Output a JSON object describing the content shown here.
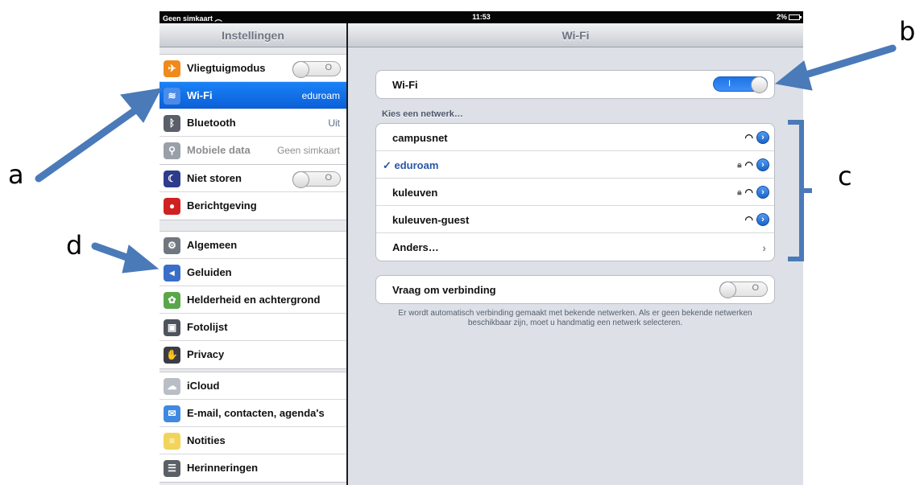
{
  "status_bar": {
    "carrier": "Geen simkaart",
    "time": "11:53",
    "battery": "2%"
  },
  "sidebar": {
    "title": "Instellingen",
    "groups": [
      {
        "items": [
          {
            "label": "Vliegtuigmodus",
            "icon": "airplane-icon",
            "color": "#f08a1c",
            "toggle": "off"
          },
          {
            "label": "Wi-Fi",
            "value": "eduroam",
            "icon": "wifi-icon",
            "color": "#4a8ce8",
            "selected": true
          },
          {
            "label": "Bluetooth",
            "value": "Uit",
            "icon": "bluetooth-icon",
            "color": "#5a5f69"
          },
          {
            "label": "Mobiele data",
            "value": "Geen simkaart",
            "icon": "cellular-icon",
            "color": "#9aa0a8",
            "disabled": true
          }
        ]
      },
      {
        "items": [
          {
            "label": "Niet storen",
            "icon": "moon-icon",
            "color": "#2f3c8c",
            "toggle": "off"
          },
          {
            "label": "Berichtgeving",
            "icon": "notifications-icon",
            "color": "#d02020"
          }
        ]
      },
      {
        "items": [
          {
            "label": "Algemeen",
            "icon": "gear-icon",
            "color": "#707780"
          },
          {
            "label": "Geluiden",
            "icon": "speaker-icon",
            "color": "#3a6ec8"
          },
          {
            "label": "Helderheid en achtergrond",
            "icon": "flower-icon",
            "color": "#5aa64a"
          },
          {
            "label": "Fotolijst",
            "icon": "photo-frame-icon",
            "color": "#4e535c"
          },
          {
            "label": "Privacy",
            "icon": "hand-icon",
            "color": "#3a3d43"
          }
        ]
      },
      {
        "items": [
          {
            "label": "iCloud",
            "icon": "cloud-icon",
            "color": "#b9bec6"
          },
          {
            "label": "E-mail, contacten, agenda's",
            "icon": "mail-icon",
            "color": "#3f8ae0"
          },
          {
            "label": "Notities",
            "icon": "notes-icon",
            "color": "#f2d45a"
          },
          {
            "label": "Herinneringen",
            "icon": "reminders-icon",
            "color": "#5b5f66"
          }
        ]
      }
    ]
  },
  "detail": {
    "title": "Wi-Fi",
    "wifi_row": {
      "label": "Wi-Fi",
      "toggle": "on",
      "toggle_text": "I"
    },
    "section_label": "Kies een netwerk…",
    "networks": [
      {
        "name": "campusnet",
        "locked": false,
        "checked": false
      },
      {
        "name": "eduroam",
        "locked": true,
        "checked": true
      },
      {
        "name": "kuleuven",
        "locked": true,
        "checked": false
      },
      {
        "name": "kuleuven-guest",
        "locked": false,
        "checked": false
      }
    ],
    "other_label": "Anders…",
    "ask_row": {
      "label": "Vraag om verbinding",
      "toggle": "off",
      "toggle_text": "O"
    },
    "footnote": "Er wordt automatisch verbinding gemaakt met bekende netwerken. Als er geen bekende netwerken beschikbaar zijn, moet u handmatig een netwerk selecteren."
  },
  "annotations": {
    "a": "a",
    "b": "b",
    "c": "c",
    "d": "d",
    "arrow_color": "#4a7ab8"
  }
}
